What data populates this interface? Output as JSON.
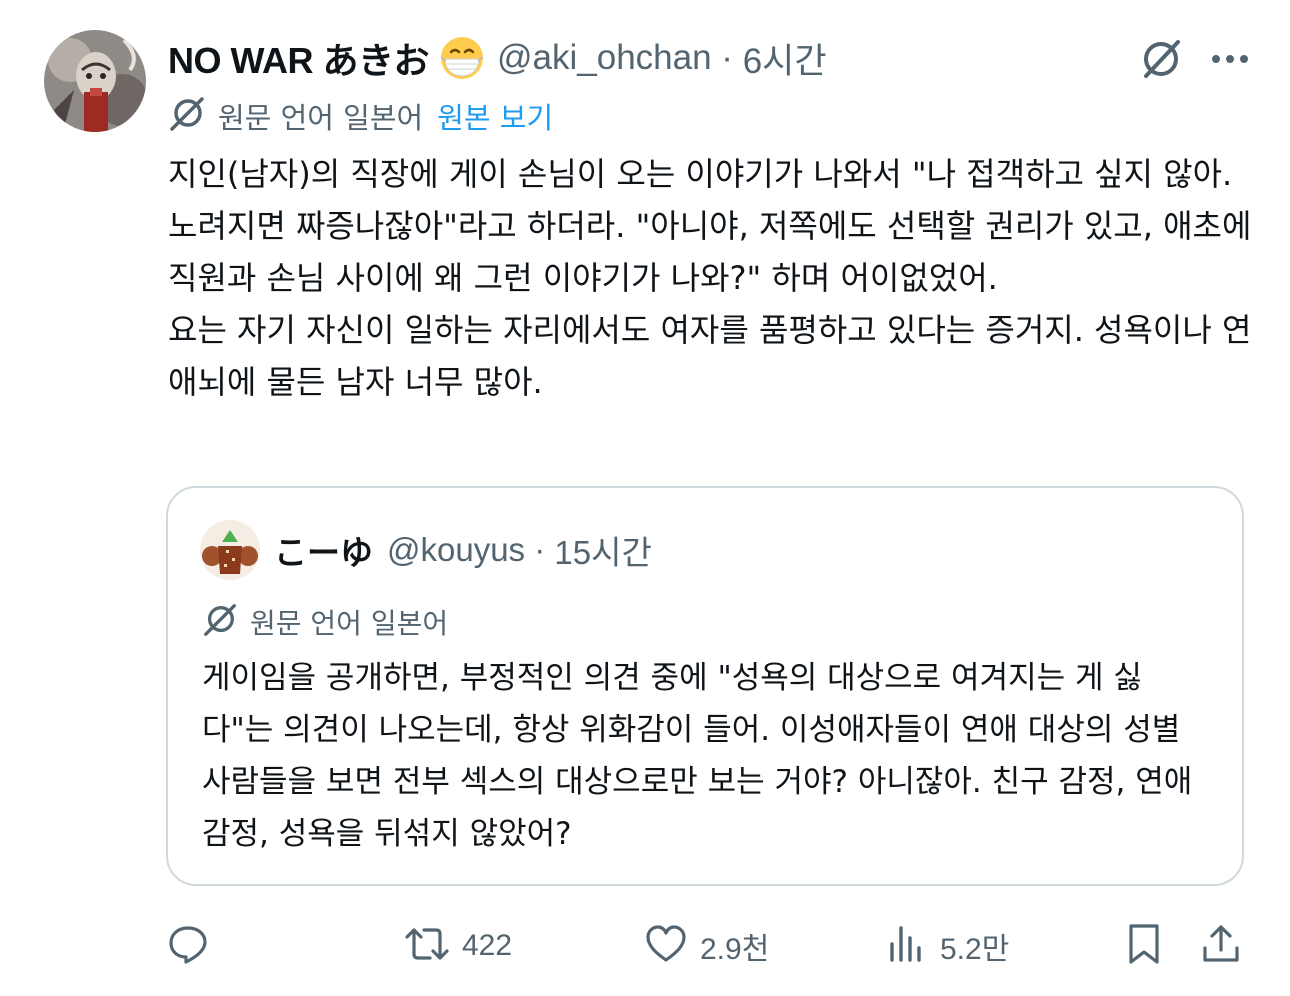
{
  "tweet": {
    "author": {
      "display_name": "NO WAR あきお",
      "handle": "@aki_ohchan",
      "time": "6시간",
      "avatar_icon": "avatar-image",
      "emoji_icon": "mask-face-emoji"
    },
    "translation": {
      "label": "원문 언어 일본어",
      "show_original": "원본 보기"
    },
    "paragraphs": [
      "지인(남자)의 직장에 게이 손님이 오는 이야기가 나와서 \"나 접객하고 싶지 않아. 노려지면 짜증나잖아\"라고 하더라. \"아니야, 저쪽에도 선택할 권리가 있고, 애초에 직원과 손님 사이에 왜 그런 이야기가 나와?\" 하며 어이없었어.",
      "요는 자기 자신이 일하는 자리에서도 여자를 품평하고 있다는 증거지. 성욕이나 연애뇌에 물든 남자 너무 많아."
    ]
  },
  "quoted_tweet": {
    "display_name": "こーゆ",
    "handle": "@kouyus",
    "time": "15시간",
    "translation_label": "원문 언어 일본어",
    "text": "게이임을 공개하면, 부정적인 의견 중에 \"성욕의 대상으로 여겨지는 게 싫다\"는 의견이 나오는데, 항상 위화감이 들어. 이성애자들이 연애 대상의 성별 사람들을 보면 전부 섹스의 대상으로만 보는 거야? 아니잖아. 친구 감정, 연애 감정, 성욕을 뒤섞지 않았어?"
  },
  "actions": {
    "reply": {
      "count": "",
      "icon": "reply-icon"
    },
    "retweet": {
      "count": "422",
      "icon": "retweet-icon"
    },
    "like": {
      "count": "2.9천",
      "icon": "heart-icon"
    },
    "views": {
      "count": "5.2만",
      "icon": "views-icon"
    },
    "bookmark": {
      "icon": "bookmark-icon"
    },
    "share": {
      "icon": "share-icon"
    }
  },
  "colors": {
    "text": "#0f1419",
    "secondary": "#536471",
    "link": "#1d9bf0",
    "border": "#cfd9de"
  }
}
